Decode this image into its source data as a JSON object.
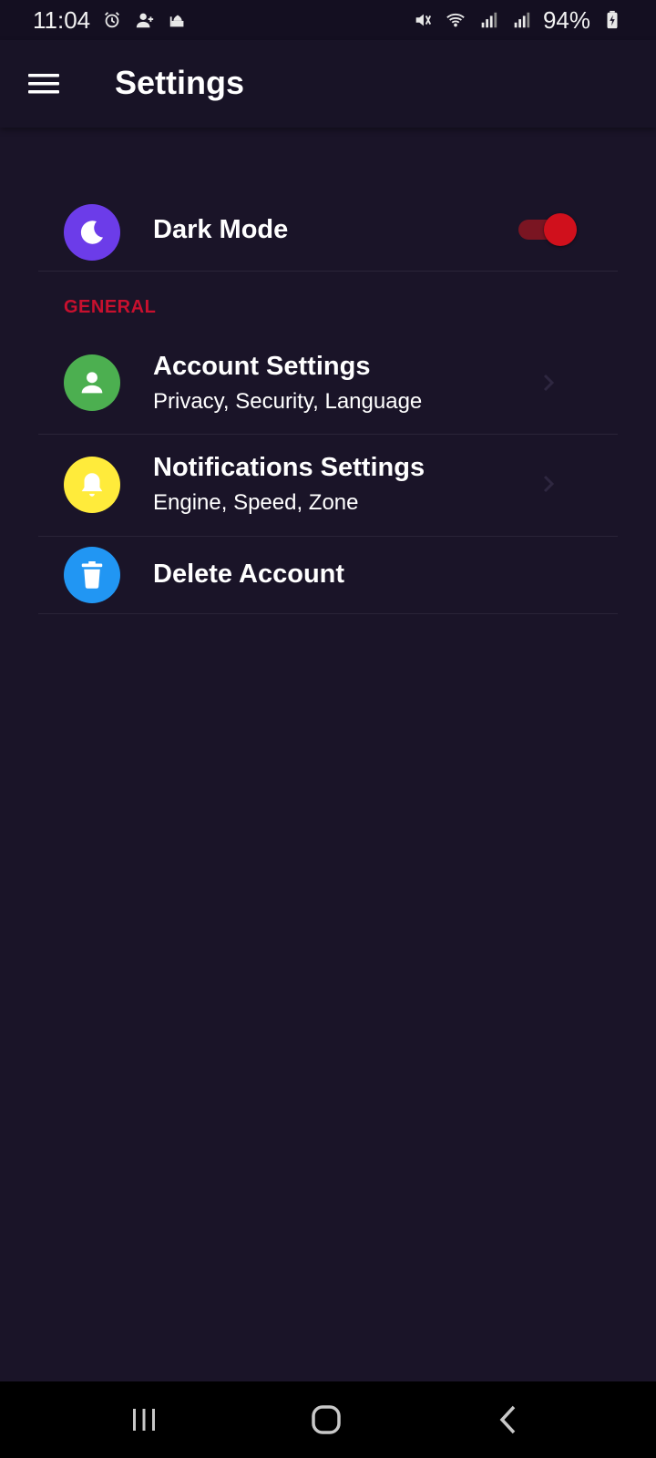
{
  "status_bar": {
    "time": "11:04",
    "battery": "94%",
    "icons": [
      "alarm-icon",
      "person-add-icon",
      "mosque-icon",
      "mute-icon",
      "wifi-icon",
      "signal-icon",
      "signal-icon",
      "battery-charging-icon"
    ]
  },
  "app_bar": {
    "title": "Settings",
    "menu_icon": "hamburger-menu-icon"
  },
  "dark_mode": {
    "label": "Dark Mode",
    "icon": "moon-icon",
    "icon_color": "#6c3ce9",
    "enabled": true,
    "toggle_color": "#d0101c"
  },
  "general": {
    "header": "GENERAL",
    "header_color": "#c8102e",
    "items": [
      {
        "title": "Account Settings",
        "subtitle": "Privacy, Security, Language",
        "icon": "person-icon",
        "icon_color": "#4caf50"
      },
      {
        "title": "Notifications Settings",
        "subtitle": "Engine, Speed, Zone",
        "icon": "bell-icon",
        "icon_color": "#ffeb3b"
      },
      {
        "title": "Delete Account",
        "icon": "trash-icon",
        "icon_color": "#2196f3"
      }
    ]
  },
  "nav_bar": {
    "buttons": [
      "recent-apps-icon",
      "home-icon",
      "back-icon"
    ]
  },
  "colors": {
    "background": "#1a1428",
    "app_bar": "#181326",
    "divider": "#2a2438"
  }
}
